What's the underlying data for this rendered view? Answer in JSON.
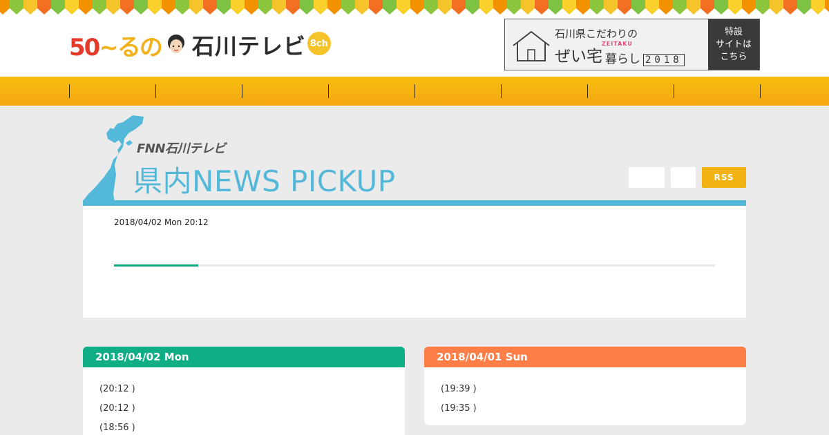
{
  "header": {
    "logo": {
      "part1": "50",
      "part2": "~るの",
      "name": "石川テレビ",
      "channel": "8ch",
      "face_icon": "face-icon"
    },
    "promo": {
      "line1": "石川県こだわりの",
      "main": "ぜい宅",
      "sub": "暮らし",
      "ruby": "ZEITAKU",
      "year": "2018",
      "side_lines": [
        "特設",
        "サイトは",
        "こちら"
      ]
    }
  },
  "nav": {
    "color": "#f6b412",
    "item_count": 8
  },
  "news_header": {
    "brand": "FNN石川テレビ",
    "title": "県内NEWS  PICKUP",
    "rss_label": "RSS",
    "accent": "#54b8d9"
  },
  "feature": {
    "date": "2018/04/02 Mon 20:12",
    "progress": 0.14
  },
  "days": [
    {
      "heading": "2018/04/02 Mon",
      "color": "#0fae84",
      "items": [
        "(20:12 )",
        "(20:12 )",
        "(18:56 )"
      ]
    },
    {
      "heading": "2018/04/01 Sun",
      "color": "#fd7e46",
      "items": [
        "(19:39 )",
        "(19:35 )"
      ]
    }
  ]
}
